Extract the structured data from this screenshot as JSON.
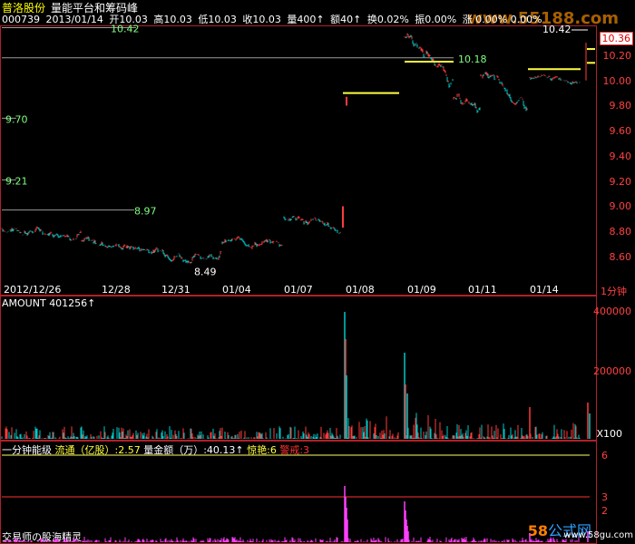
{
  "header": {
    "stock_name": "普洛股份",
    "indicator_name": "量能平台和筹码峰",
    "watermark": "www.55188.com"
  },
  "info_bar": {
    "code": "000739",
    "date": "2013/01/14",
    "open": "开10.03",
    "high": "高10.03",
    "low": "低10.03",
    "close": "收10.03",
    "volume": "量400↑",
    "amount": "额40↑",
    "turnover": "换0.02%",
    "amplitude": "振0.00%",
    "change": "涨 0.00% 0.00%"
  },
  "price_panel": {
    "last_price": "10.36",
    "peak_label": "10.42",
    "y_ticks": [
      "10.20",
      "10.00",
      "9.80",
      "9.60",
      "9.40",
      "9.20",
      "9.00",
      "8.80",
      "8.60"
    ],
    "level_labels": [
      "10.42",
      "10.18",
      "9.70",
      "9.21",
      "8.97",
      "8.49"
    ],
    "x_labels": [
      "2012/12/26",
      "12/28",
      "12/31",
      "01/04",
      "01/07",
      "01/08",
      "01/09",
      "01/11",
      "01/14"
    ],
    "period": "1分钟"
  },
  "amount_panel": {
    "label": "AMOUNT",
    "value": "401256↑",
    "y_ticks": [
      "400000",
      "200000"
    ],
    "unit": "X100"
  },
  "indicator_panel": {
    "name": "一分钟能级",
    "float_label": "流通（亿股）:2.57",
    "amount_label": "量金额（万）:40.13↑",
    "alert_label": "惊艳:6",
    "warning_label": "警戒:3",
    "y_ticks": [
      "6",
      "3",
      "2"
    ]
  },
  "footer": {
    "left_text": "交易师の股海精灵",
    "logo_num": "58",
    "logo_text": "公式网",
    "site": "www.58gu.com"
  },
  "colors": {
    "up": "#ff3b3b",
    "down": "#00c8c8",
    "level_line": "#ffff40",
    "volume_pink": "#ff40ff",
    "border": "#b0202a"
  }
}
